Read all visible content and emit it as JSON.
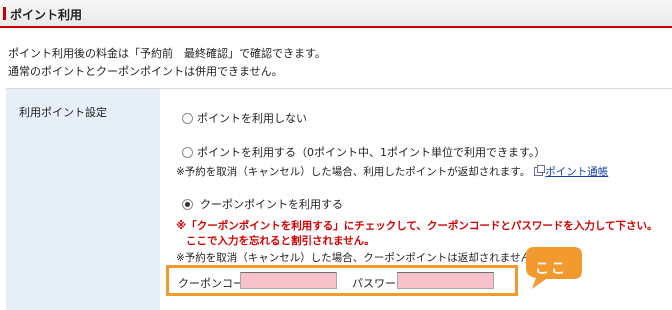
{
  "header": {
    "title": "ポイント利用"
  },
  "intro": {
    "line1": "ポイント利用後の料金は「予約前　最終確認」で確認できます。",
    "line2": "通常のポイントとクーポンポイントは併用できません。"
  },
  "panel": {
    "label": "利用ポイント設定",
    "options": [
      {
        "label": "ポイントを利用しない",
        "checked": false
      },
      {
        "label": "ポイントを利用する（0ポイント中、1ポイント単位で利用できます。）",
        "checked": false
      },
      {
        "label": "クーポンポイントを利用する",
        "checked": true
      }
    ],
    "note1": "※予約を取消（キャンセル）した場合、利用したポイントが返却されます。",
    "note1_link": "ポイント通帳",
    "warning1": "※「クーポンポイントを利用する」にチェックして、クーポンコードとパスワードを入力して下さい。",
    "warning2": "ここで入力を忘れると割引されません。",
    "note2": "※予約を取消（キャンセル）した場合、クーポンポイントは返却されません。",
    "coupon_code_label": "クーポンコード",
    "coupon_code_value": "",
    "password_label": "パスワード",
    "password_value": ""
  },
  "callout": {
    "text": "ここ",
    "color": "#f29a2e"
  },
  "colors": {
    "accent_red": "#c40000",
    "warning_red": "#d40000",
    "field_pink": "#f6c1c9",
    "side_blue": "#e6eef8"
  }
}
